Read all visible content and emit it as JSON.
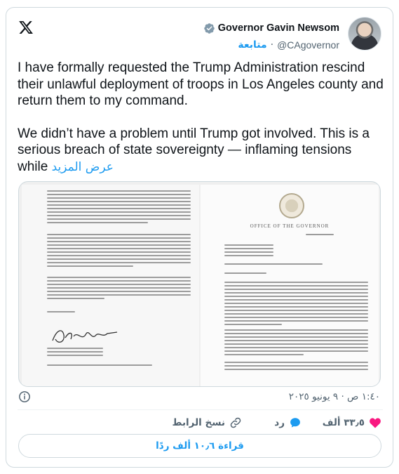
{
  "header": {
    "name": "Governor Gavin Newsom",
    "handle": "@CAgovernor",
    "follow_label": "متابعة",
    "dot": "·"
  },
  "tweet": {
    "paragraph1": "I have formally requested the Trump Administration rescind their unlawful deployment of troops in Los Angeles county and return them to my command.",
    "paragraph2": "We didn’t have a problem until Trump got involved. This is a serious breach of state sovereignty — inflaming tensions while",
    "show_more": "عرض المزيد"
  },
  "media": {
    "office_heading": "OFFICE OF THE GOVERNOR"
  },
  "meta": {
    "timestamp": "١:٤٠ ص · ٩ يونيو ٢٠٢٥"
  },
  "actions": {
    "like_count": "٣٣٫٥ ألف",
    "reply_label": "رد",
    "copy_link_label": "نسخ الرابط"
  },
  "replies": {
    "read_label": "قراءة ١٠٫٦ ألف ردًا"
  },
  "colors": {
    "accent": "#1d9bf0",
    "like": "#f91880",
    "muted": "#536471"
  },
  "icons": {
    "logo": "x-logo-icon",
    "verified": "verified-badge-icon",
    "info": "info-icon",
    "like": "heart-icon",
    "reply": "reply-bubble-icon",
    "copy": "link-icon"
  }
}
